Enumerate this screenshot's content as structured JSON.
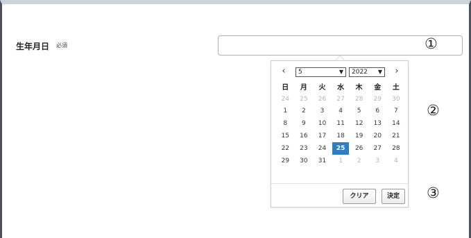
{
  "field": {
    "label": "生年月日",
    "required": "必須",
    "value": ""
  },
  "callouts": {
    "one": "①",
    "two": "②",
    "three": "③"
  },
  "calendar": {
    "prev_icon": "‹",
    "next_icon": "›",
    "month": "5",
    "year": "2022",
    "weekdays": [
      "日",
      "月",
      "火",
      "水",
      "木",
      "金",
      "土"
    ],
    "weeks": [
      [
        "24",
        "25",
        "26",
        "27",
        "28",
        "29",
        "30"
      ],
      [
        "1",
        "2",
        "3",
        "4",
        "5",
        "6",
        "7"
      ],
      [
        "8",
        "9",
        "10",
        "11",
        "12",
        "13",
        "14"
      ],
      [
        "15",
        "16",
        "17",
        "18",
        "19",
        "20",
        "21"
      ],
      [
        "22",
        "23",
        "24",
        "25",
        "26",
        "27",
        "28"
      ],
      [
        "29",
        "30",
        "31",
        "1",
        "2",
        "3",
        "4"
      ]
    ],
    "selected": "25",
    "selected_color": "#2f7ec2",
    "clear_label": "クリア",
    "ok_label": "決定"
  }
}
